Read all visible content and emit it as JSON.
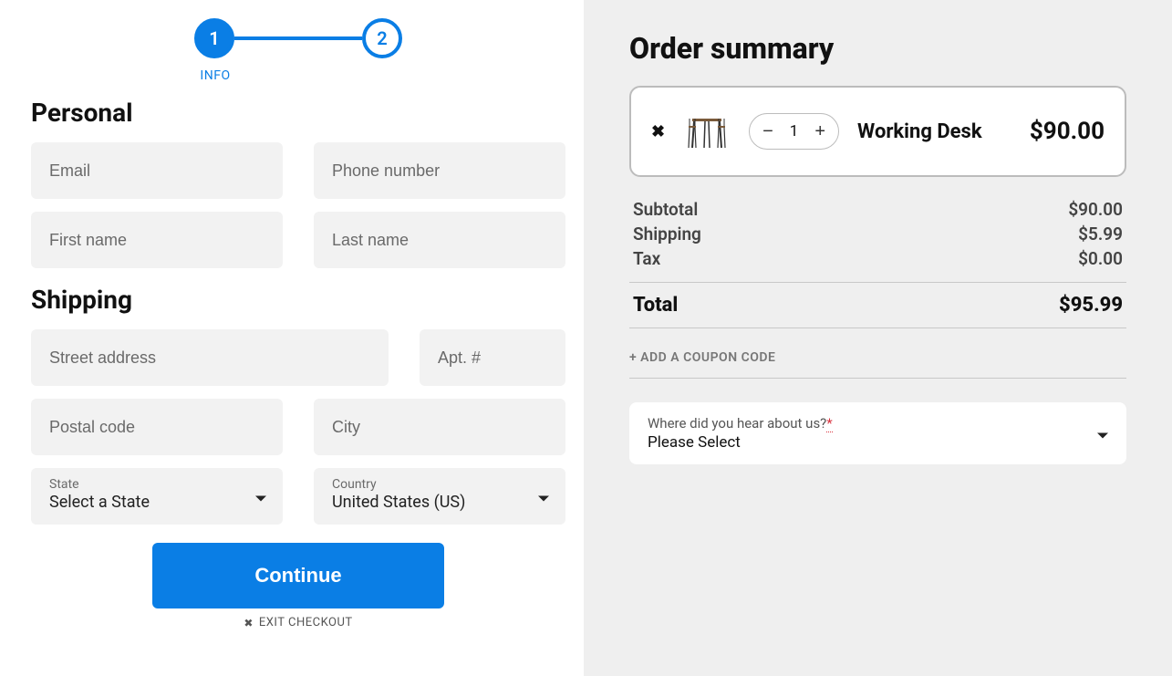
{
  "stepper": {
    "step1": "1",
    "step2": "2",
    "label": "INFO"
  },
  "personal": {
    "title": "Personal",
    "email_ph": "Email",
    "phone_ph": "Phone number",
    "first_ph": "First name",
    "last_ph": "Last name"
  },
  "shipping": {
    "title": "Shipping",
    "street_ph": "Street address",
    "apt_ph": "Apt. #",
    "postal_ph": "Postal code",
    "city_ph": "City",
    "state_label": "State",
    "state_value": "Select a State",
    "country_label": "Country",
    "country_value": "United States (US)"
  },
  "actions": {
    "continue": "Continue",
    "exit": "EXIT CHECKOUT"
  },
  "summary": {
    "title": "Order summary",
    "item": {
      "qty": "1",
      "name": "Working Desk",
      "price": "$90.00"
    },
    "subtotal_label": "Subtotal",
    "subtotal_value": "$90.00",
    "shipping_label": "Shipping",
    "shipping_value": "$5.99",
    "tax_label": "Tax",
    "tax_value": "$0.00",
    "total_label": "Total",
    "total_value": "$95.99",
    "coupon": "+ ADD A COUPON CODE",
    "hear_label": "Where did you hear about us?",
    "hear_req": "*",
    "hear_value": "Please Select"
  }
}
